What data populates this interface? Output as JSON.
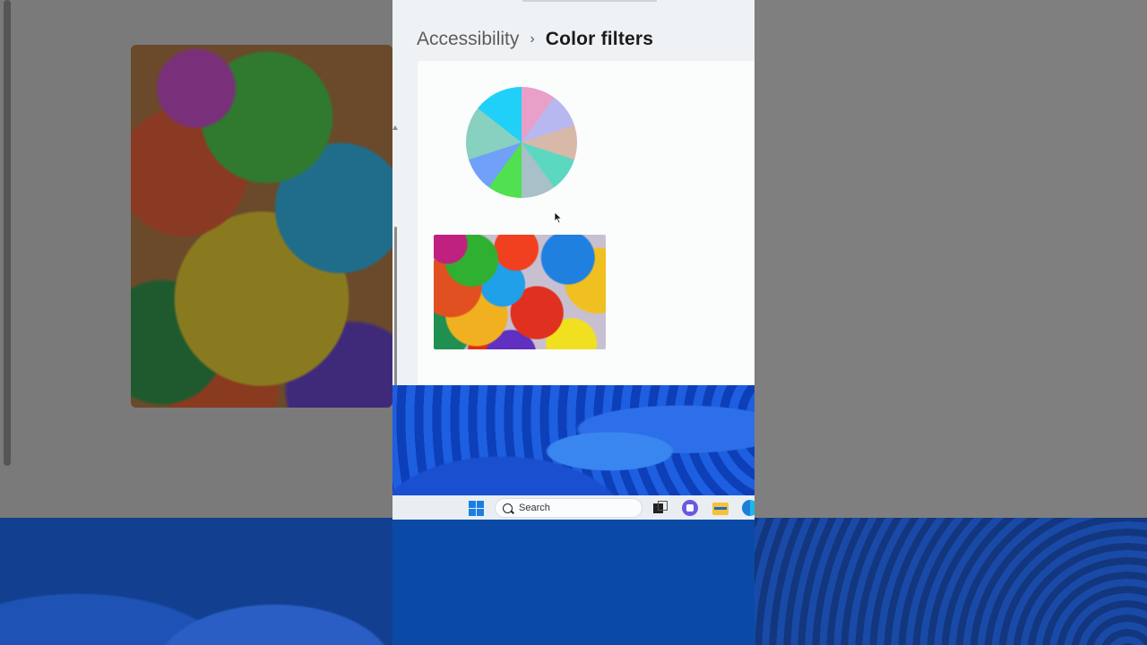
{
  "breadcrumb": {
    "parent": "Accessibility",
    "separator": "›",
    "current": "Color filters"
  },
  "preview": {
    "wheel_icon": "color-wheel",
    "photo_icon": "colorful-paper-fans-photo"
  },
  "taskbar": {
    "search_label": "Search",
    "icons": [
      "windows-start-icon",
      "search-icon",
      "task-view-icon",
      "teams-chat-icon",
      "file-explorer-icon",
      "edge-icon"
    ]
  },
  "colors": {
    "accent": "#1a7fe0",
    "wallpaper": "#1a5ad8"
  }
}
